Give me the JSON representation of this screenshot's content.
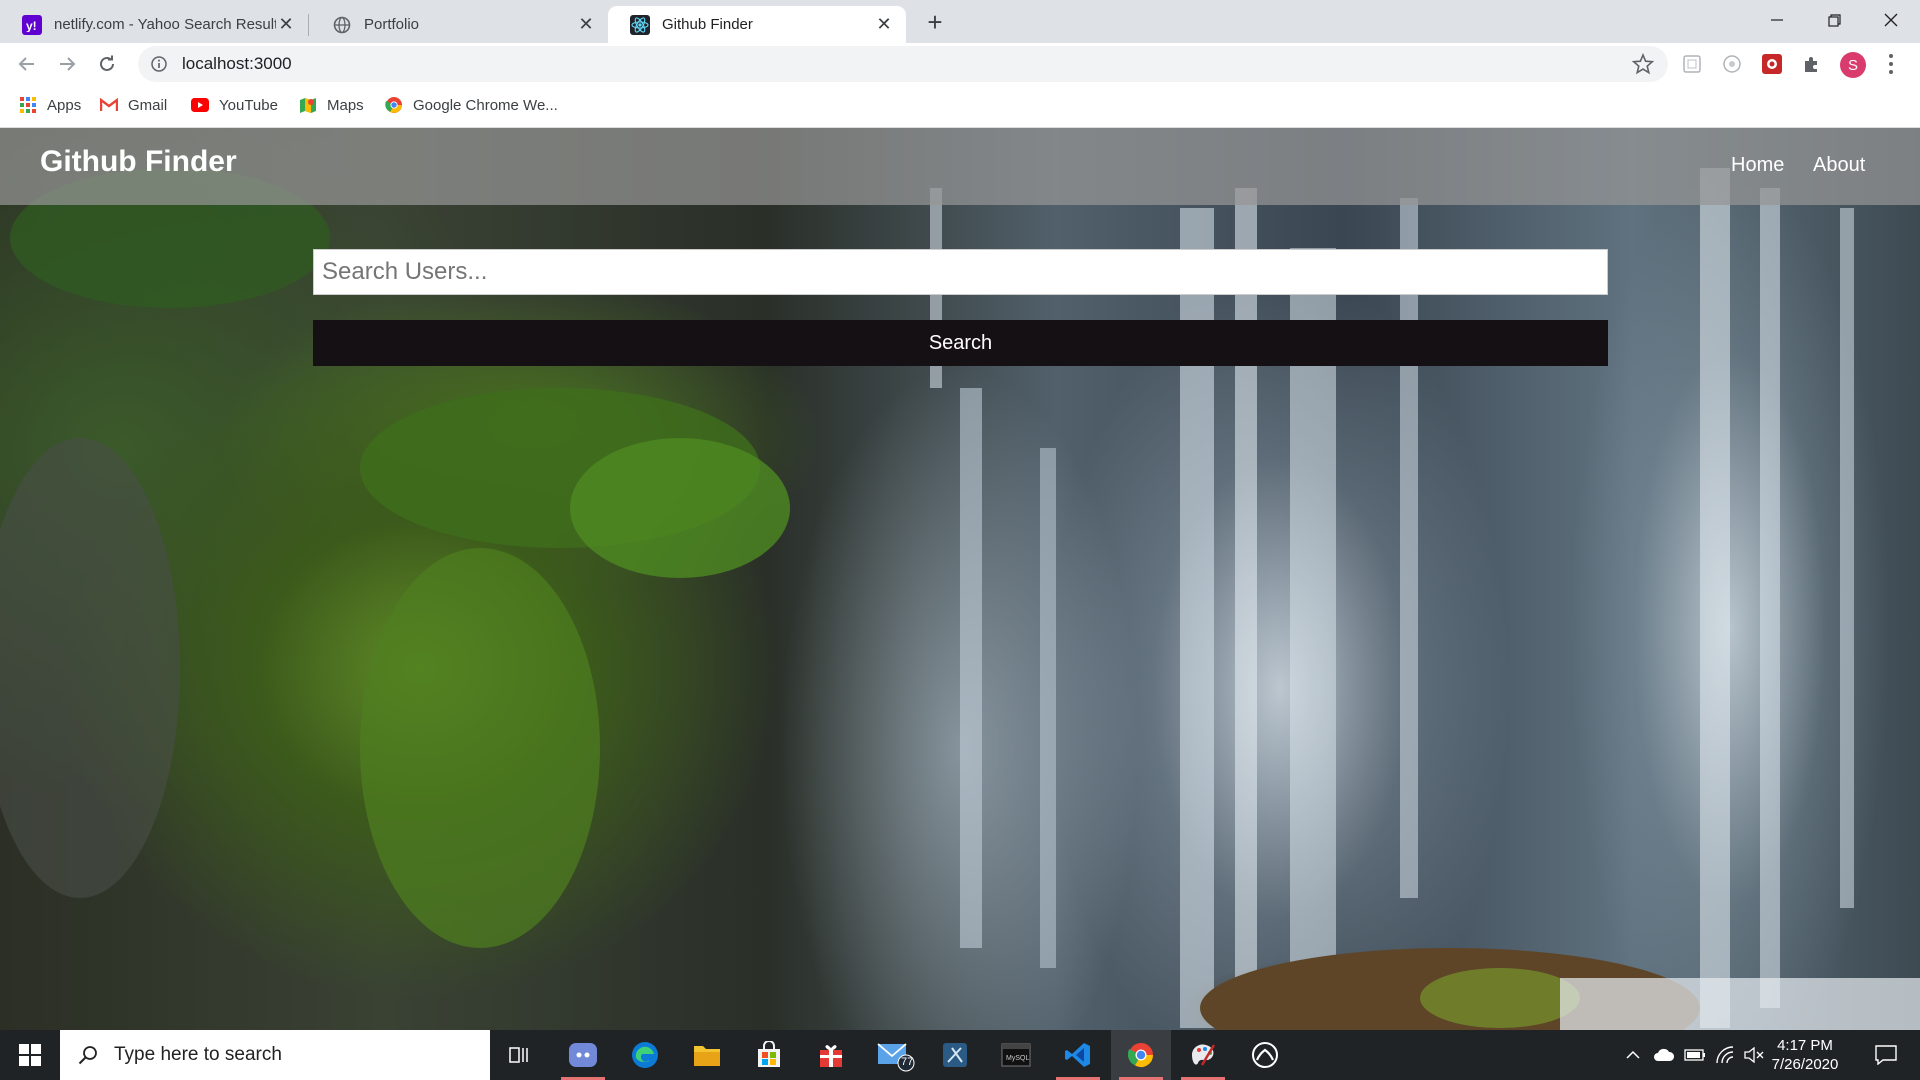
{
  "browser": {
    "tabs": [
      {
        "title": "netlify.com - Yahoo Search Results",
        "favicon": "yahoo-icon",
        "active": false
      },
      {
        "title": "Portfolio",
        "favicon": "globe-icon",
        "active": false
      },
      {
        "title": "Github Finder",
        "favicon": "react-icon",
        "active": true
      }
    ],
    "url": "localhost:3000",
    "profile_initial": "S",
    "bookmarks": [
      {
        "label": "Apps",
        "icon": "apps-grid-icon"
      },
      {
        "label": "Gmail",
        "icon": "gmail-icon"
      },
      {
        "label": "YouTube",
        "icon": "youtube-icon"
      },
      {
        "label": "Maps",
        "icon": "maps-icon"
      },
      {
        "label": "Google Chrome We...",
        "icon": "chrome-icon"
      }
    ]
  },
  "page": {
    "brand": "Github Finder",
    "nav": {
      "home": "Home",
      "about": "About"
    },
    "search": {
      "placeholder": "Search Users...",
      "value": "",
      "button_label": "Search"
    }
  },
  "taskbar": {
    "search_placeholder": "Type here to search",
    "mail_badge": "77",
    "time": "4:17 PM",
    "date": "7/26/2020"
  },
  "colors": {
    "navbar": "#969696",
    "search_button": "#141014",
    "active_tab": "#ffffff",
    "tab_strip": "#dee1e6",
    "taskbar": "#202326",
    "profile": "#d93b6d"
  }
}
